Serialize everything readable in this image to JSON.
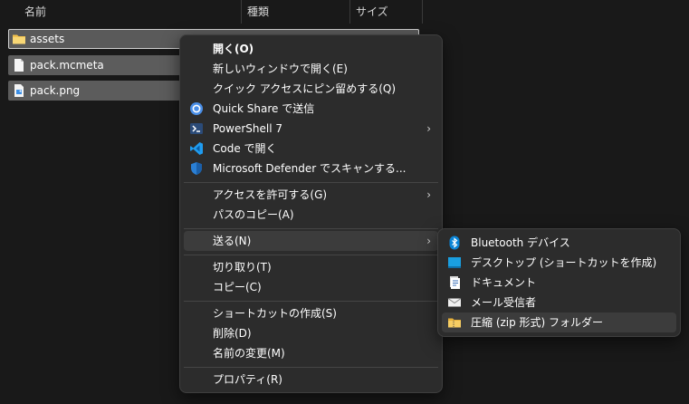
{
  "columns": {
    "name": "名前",
    "type": "種類",
    "size": "サイズ"
  },
  "files": [
    {
      "name": "assets",
      "icon": "folder-icon"
    },
    {
      "name": "pack.mcmeta",
      "icon": "file-icon"
    },
    {
      "name": "pack.png",
      "icon": "image-file-icon"
    }
  ],
  "context_menu": {
    "open": "開く(O)",
    "open_new_window": "新しいウィンドウで開く(E)",
    "pin_quick_access": "クイック アクセスにピン留めする(Q)",
    "quick_share": "Quick Share で送信",
    "powershell": "PowerShell 7",
    "open_in_code": "Code で開く",
    "defender_scan": "Microsoft Defender でスキャンする...",
    "give_access": "アクセスを許可する(G)",
    "copy_path": "パスのコピー(A)",
    "send_to": "送る(N)",
    "cut": "切り取り(T)",
    "copy": "コピー(C)",
    "create_shortcut": "ショートカットの作成(S)",
    "delete": "削除(D)",
    "rename": "名前の変更(M)",
    "properties": "プロパティ(R)"
  },
  "send_to_menu": {
    "bluetooth": "Bluetooth デバイス",
    "desktop": "デスクトップ (ショートカットを作成)",
    "documents": "ドキュメント",
    "mail": "メール受信者",
    "zip": "圧縮 (zip 形式) フォルダー"
  },
  "colors": {
    "background": "#191919",
    "menu_background": "#2c2c2c",
    "selection": "#5c5c5c",
    "highlight": "#3c3c3c",
    "folder_yellow": "#f2c14e",
    "accent_blue": "#0a84d6"
  }
}
